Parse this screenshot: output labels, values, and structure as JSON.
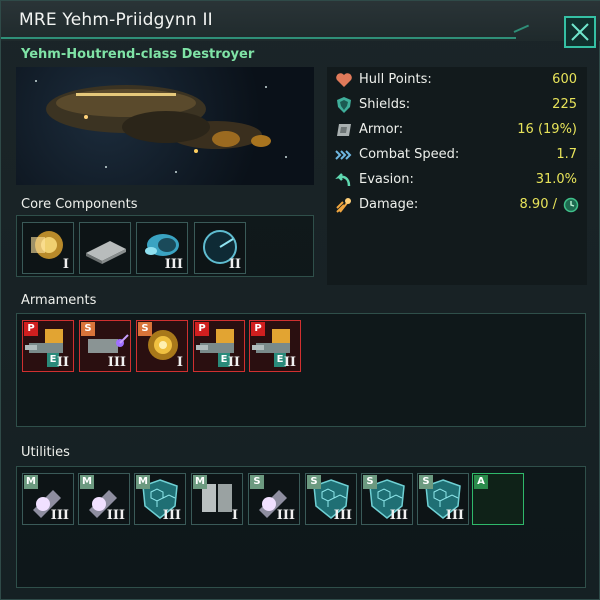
{
  "window": {
    "title": "MRE Yehm-Priidgynn II"
  },
  "ship": {
    "class_name": "Yehm-Houtrend-class Destroyer"
  },
  "stats": [
    {
      "label": "Hull Points:",
      "value": "600",
      "icon": "heart-icon"
    },
    {
      "label": "Shields:",
      "value": "225",
      "icon": "shield-icon"
    },
    {
      "label": "Armor:",
      "value": "16 (19%)",
      "icon": "armor-plate-icon"
    },
    {
      "label": "Combat Speed:",
      "value": "1.7",
      "icon": "speed-arrows-icon"
    },
    {
      "label": "Evasion:",
      "value": "31.0%",
      "icon": "evasion-arrow-icon"
    },
    {
      "label": "Damage:",
      "value": "8.90 /",
      "icon": "damage-burst-icon"
    }
  ],
  "sections": {
    "core": "Core Components",
    "armaments": "Armaments",
    "utilities": "Utilities"
  },
  "core_components": [
    {
      "tier": "I",
      "icon": "reactor-icon"
    },
    {
      "tier": "",
      "icon": "computer-chip-icon"
    },
    {
      "tier": "III",
      "icon": "thruster-icon"
    },
    {
      "tier": "II",
      "icon": "sensor-radar-icon"
    }
  ],
  "armaments": [
    {
      "size": "P",
      "tier": "II",
      "energy": "E",
      "icon": "turret-icon"
    },
    {
      "size": "S",
      "tier": "III",
      "energy": "",
      "icon": "laser-cannon-icon"
    },
    {
      "size": "S",
      "tier": "I",
      "energy": "",
      "icon": "plasma-gold-icon"
    },
    {
      "size": "P",
      "tier": "II",
      "energy": "E",
      "icon": "turret-icon"
    },
    {
      "size": "P",
      "tier": "II",
      "energy": "E",
      "icon": "turret-icon"
    }
  ],
  "utilities": [
    {
      "size": "M",
      "tier": "III",
      "icon": "shield-emitter-icon"
    },
    {
      "size": "M",
      "tier": "III",
      "icon": "shield-emitter-icon"
    },
    {
      "size": "M",
      "tier": "III",
      "icon": "hex-shield-icon"
    },
    {
      "size": "M",
      "tier": "I",
      "icon": "armor-plate-icon"
    },
    {
      "size": "S",
      "tier": "III",
      "icon": "shield-emitter-icon"
    },
    {
      "size": "S",
      "tier": "III",
      "icon": "hex-shield-icon"
    },
    {
      "size": "S",
      "tier": "III",
      "icon": "hex-shield-icon"
    },
    {
      "size": "S",
      "tier": "III",
      "icon": "hex-shield-icon"
    },
    {
      "size": "A",
      "tier": "",
      "icon": "empty-aux-slot"
    }
  ],
  "colors": {
    "accent": "#35c0a4",
    "subtitle": "#7fe3a6",
    "stat_value": "#e7e35a",
    "weapon_border": "#d03030",
    "aux_border": "#2fb86a"
  }
}
